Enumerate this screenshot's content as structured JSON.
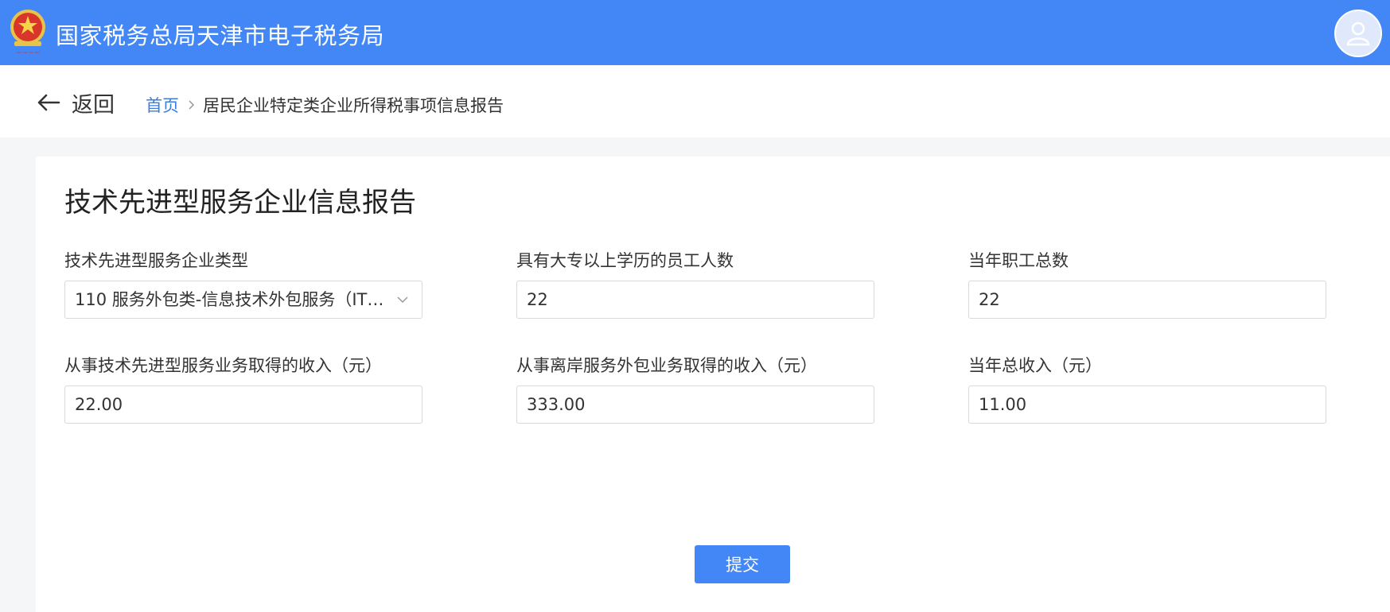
{
  "header": {
    "title": "国家税务总局天津市电子税务局",
    "logo_icon": "tax-emblem-icon",
    "avatar_icon": "user-icon"
  },
  "nav": {
    "back_label": "返回",
    "back_icon": "arrow-left-icon",
    "breadcrumb": {
      "home": "首页",
      "current": "居民企业特定类企业所得税事项信息报告"
    }
  },
  "form": {
    "title": "技术先进型服务企业信息报告",
    "fields": [
      {
        "label": "技术先进型服务企业类型",
        "value": "110 服务外包类-信息技术外包服务（IT ...",
        "type": "select"
      },
      {
        "label": "具有大专以上学历的员工人数",
        "value": "22",
        "type": "input"
      },
      {
        "label": "当年职工总数",
        "value": "22",
        "type": "input"
      },
      {
        "label": "从事技术先进型服务业务取得的收入（元）",
        "value": "22.00",
        "type": "input"
      },
      {
        "label": "从事离岸服务外包业务取得的收入（元）",
        "value": "333.00",
        "type": "input"
      },
      {
        "label": "当年总收入（元）",
        "value": "11.00",
        "type": "input"
      }
    ],
    "submit_label": "提交"
  },
  "colors": {
    "brand": "#4287f5",
    "link": "#3b7ddd"
  }
}
